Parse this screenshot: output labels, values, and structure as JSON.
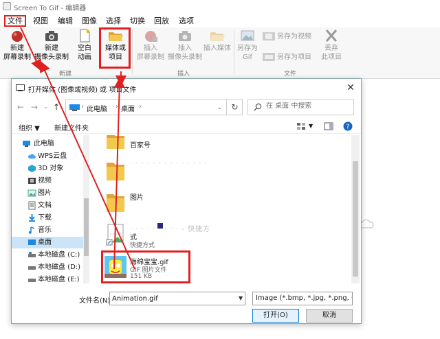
{
  "app": {
    "title": "Screen To Gif - 编辑器"
  },
  "menu": [
    {
      "label": "文件",
      "active": true
    },
    {
      "label": "视图"
    },
    {
      "label": "编辑"
    },
    {
      "label": "图像"
    },
    {
      "label": "选择"
    },
    {
      "label": "切换"
    },
    {
      "label": "回放"
    },
    {
      "label": "选项"
    }
  ],
  "ribbon": {
    "new_screen": "新建\n屏幕录制",
    "new_webcam": "新建\n摄像头录制",
    "blank_anim": "空白\n动画",
    "media_project": "媒体或\n项目",
    "group_new": "新建",
    "insert_screen": "插入\n屏幕录制",
    "insert_webcam": "插入\n摄像头录制",
    "insert_media": "插入媒体",
    "group_insert": "插入",
    "save_as_gif": "另存为\nGif",
    "save_as_video": "另存为视频",
    "save_as_project": "另存为项目",
    "discard": "丢弃\n此项目",
    "group_file": "文件"
  },
  "dialog": {
    "title": "打开媒体 (图像或视频) 或 项目文件",
    "close": "✕",
    "breadcrumb": [
      "此电脑",
      "桌面"
    ],
    "search_placeholder": "在 桌面 中搜索",
    "organize": "组织 ▼",
    "new_folder": "新建文件夹",
    "nav_items": [
      {
        "label": "此电脑"
      },
      {
        "label": "WPS云盘"
      },
      {
        "label": "3D 对象"
      },
      {
        "label": "视频"
      },
      {
        "label": "图片"
      },
      {
        "label": "文档"
      },
      {
        "label": "下载"
      },
      {
        "label": "音乐"
      },
      {
        "label": "桌面",
        "selected": true
      },
      {
        "label": "本地磁盘 (C:)"
      },
      {
        "label": "本地磁盘 (D:)"
      },
      {
        "label": "本地磁盘 (E:)"
      }
    ],
    "files": [
      {
        "name": "百家号"
      },
      {
        "name": "· · · · · · · · · · · · · ·"
      },
      {
        "name": "图片"
      },
      {
        "name": "· · · · · · · · · - 快捷方",
        "line2": "式",
        "sub": "快捷方式"
      },
      {
        "name": "海绵宝宝.gif",
        "sub": "GIF 图片文件",
        "size": "151 KB"
      }
    ],
    "filename_label": "文件名(N):",
    "filename_value": "Animation.gif",
    "filetype": "Image (*.bmp, *.jpg, *.png, *",
    "open_button": "打开(O)",
    "cancel_button": "取消"
  },
  "colors": {
    "highlight": "#e02020",
    "folder": "#f2c94c",
    "selection": "#cce4f7"
  }
}
